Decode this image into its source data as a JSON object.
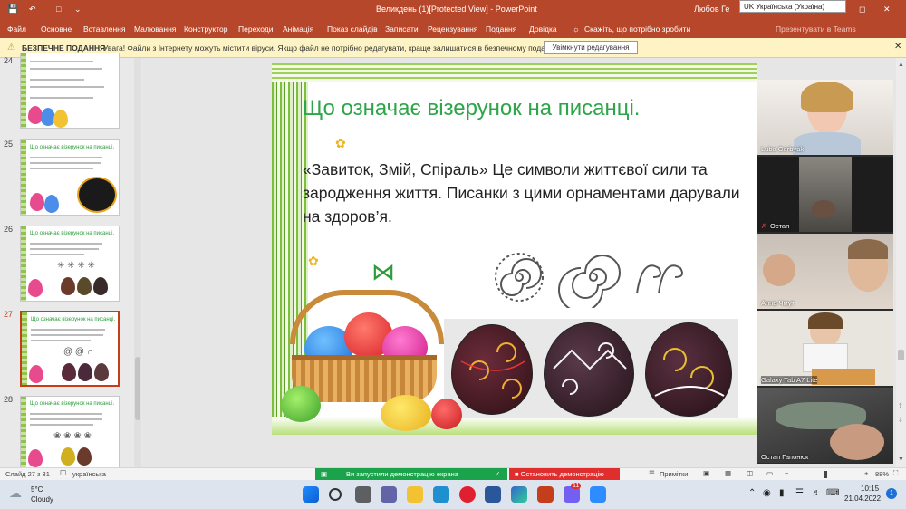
{
  "titlebar": {
    "document_title": "Великдень (1)[Protected View]  -  PowerPoint",
    "user": "Любов Ге",
    "language_tooltip": "UK Українська (Україна)"
  },
  "ribbon": {
    "tabs": [
      "Файл",
      "Основне",
      "Вставлення",
      "Малювання",
      "Конструктор",
      "Переходи",
      "Анімація",
      "Показ слайдів",
      "Записати",
      "Рецензування",
      "Подання",
      "Довідка"
    ],
    "tell_me": "Скажіть, що потрібно зробити",
    "teams": "Презентувати в Teams"
  },
  "protected_bar": {
    "label": "БЕЗПЕЧНЕ ПОДАННЯ",
    "message": "Увага! Файли з Інтернету можуть містити віруси. Якщо файл не потрібно редагувати, краще залишатися в безпечному поданні.",
    "enable_button": "Увімкнути редагування"
  },
  "thumbnails": [
    {
      "number": "24",
      "title": ""
    },
    {
      "number": "25",
      "title": "Що означає візерунок на писанці."
    },
    {
      "number": "26",
      "title": "Що означає візерунок на писанці."
    },
    {
      "number": "27",
      "title": "Що означає візерунок на писанці.",
      "selected": true
    },
    {
      "number": "28",
      "title": "Що означає візерунок на писанці."
    }
  ],
  "slide": {
    "title": "Що означає візерунок на писанці.",
    "body": "«Завиток, Змій, Спіраль» Це символи життєвої сили та зародження життя. Писанки з цими орнаментами дарували на здоров’я."
  },
  "participants": [
    "Luba Gerbyak",
    "Остап",
    "Анна Чмут",
    "Galaxy Tab A7 Lite",
    "Остап Гапонюк"
  ],
  "sharing": {
    "status": "Ви запустили демонстрацію екрана",
    "stop_button": "Остановить демонстрацію"
  },
  "statusbar": {
    "slide_counter": "Слайд 27 з 31",
    "language": "українська",
    "notes": "Примітки",
    "zoom": "88%"
  },
  "taskbar": {
    "temperature": "5°C",
    "weather": "Cloudy",
    "time": "10:15",
    "date": "21.04.2022",
    "viber_badge": "11",
    "notification_badge": "1"
  },
  "colors": {
    "accent": "#b7472a",
    "slide_title": "#2ea54a",
    "share_green": "#1aa34a",
    "share_red": "#e02e2e"
  }
}
